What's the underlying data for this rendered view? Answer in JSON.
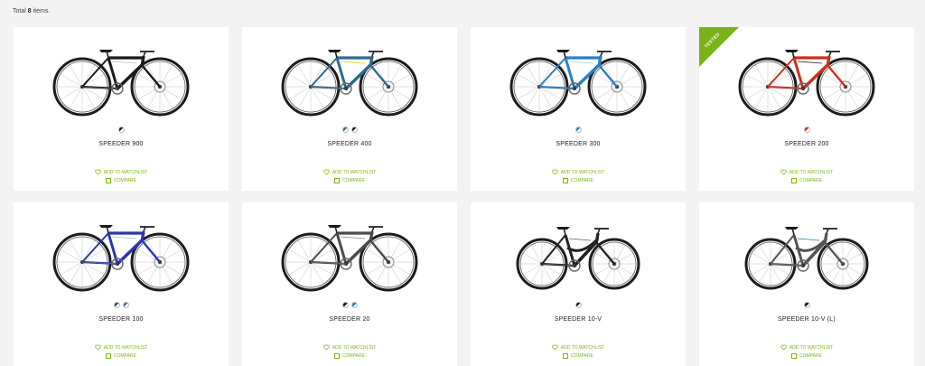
{
  "listing": {
    "total_prefix": "Total",
    "total_count": "8",
    "total_suffix": "items."
  },
  "products": [
    {
      "model": "SPEEDER 900",
      "frame_color": "#1a1a1a",
      "accent": "#bdbdbd",
      "swatches": [
        "#1a1a1a"
      ],
      "badge": "",
      "watch_label": "ADD TO WATCHLIST",
      "compare_label": "COMPARE",
      "icon": "bicycle-icon"
    },
    {
      "model": "SPEEDER 400",
      "frame_color": "#2d6b8a",
      "accent": "#e6c21a",
      "swatches": [
        "#2d6b8a",
        "#1a1a1a"
      ],
      "badge": "",
      "watch_label": "ADD TO WATCHLIST",
      "compare_label": "COMPARE",
      "icon": "bicycle-icon"
    },
    {
      "model": "SPEEDER 300",
      "frame_color": "#2a7fc1",
      "accent": "#9ad0ef",
      "swatches": [
        "#2a7fc1"
      ],
      "badge": "",
      "watch_label": "ADD TO WATCHLIST",
      "compare_label": "COMPARE",
      "icon": "bicycle-icon"
    },
    {
      "model": "SPEEDER 200",
      "frame_color": "#c8321e",
      "accent": "#222222",
      "swatches": [
        "#c8321e"
      ],
      "badge": "TESTED",
      "watch_label": "ADD TO WATCHLIST",
      "compare_label": "COMPARE",
      "icon": "bicycle-icon"
    },
    {
      "model": "SPEEDER 100",
      "frame_color": "#2b36b0",
      "accent": "#9fb7e6",
      "swatches": [
        "#2b36b0",
        "#3a66c8"
      ],
      "badge": "",
      "watch_label": "ADD TO WATCHLIST",
      "compare_label": "COMPARE",
      "icon": "bicycle-icon"
    },
    {
      "model": "SPEEDER 20",
      "frame_color": "#4a4a4a",
      "accent": "#888888",
      "swatches": [
        "#1a1a1a",
        "#2a7fc1"
      ],
      "badge": "",
      "watch_label": "ADD TO WATCHLIST",
      "compare_label": "COMPARE",
      "icon": "bicycle-icon"
    },
    {
      "model": "SPEEDER 10-V",
      "frame_color": "#222222",
      "accent": "#666666",
      "swatches": [
        "#1a1a1a"
      ],
      "badge": "",
      "watch_label": "ADD TO WATCHLIST",
      "compare_label": "COMPARE",
      "icon": "bicycle-icon"
    },
    {
      "model": "SPEEDER 10-V (L)",
      "frame_color": "#555555",
      "accent": "#2a7fc1",
      "swatches": [
        "#1a1a1a"
      ],
      "badge": "",
      "watch_label": "ADD TO WATCHLIST",
      "compare_label": "COMPARE",
      "icon": "bicycle-icon"
    }
  ],
  "colors": {
    "accent_green": "#7ab317",
    "background": "#f3f3f3",
    "card": "#ffffff"
  }
}
